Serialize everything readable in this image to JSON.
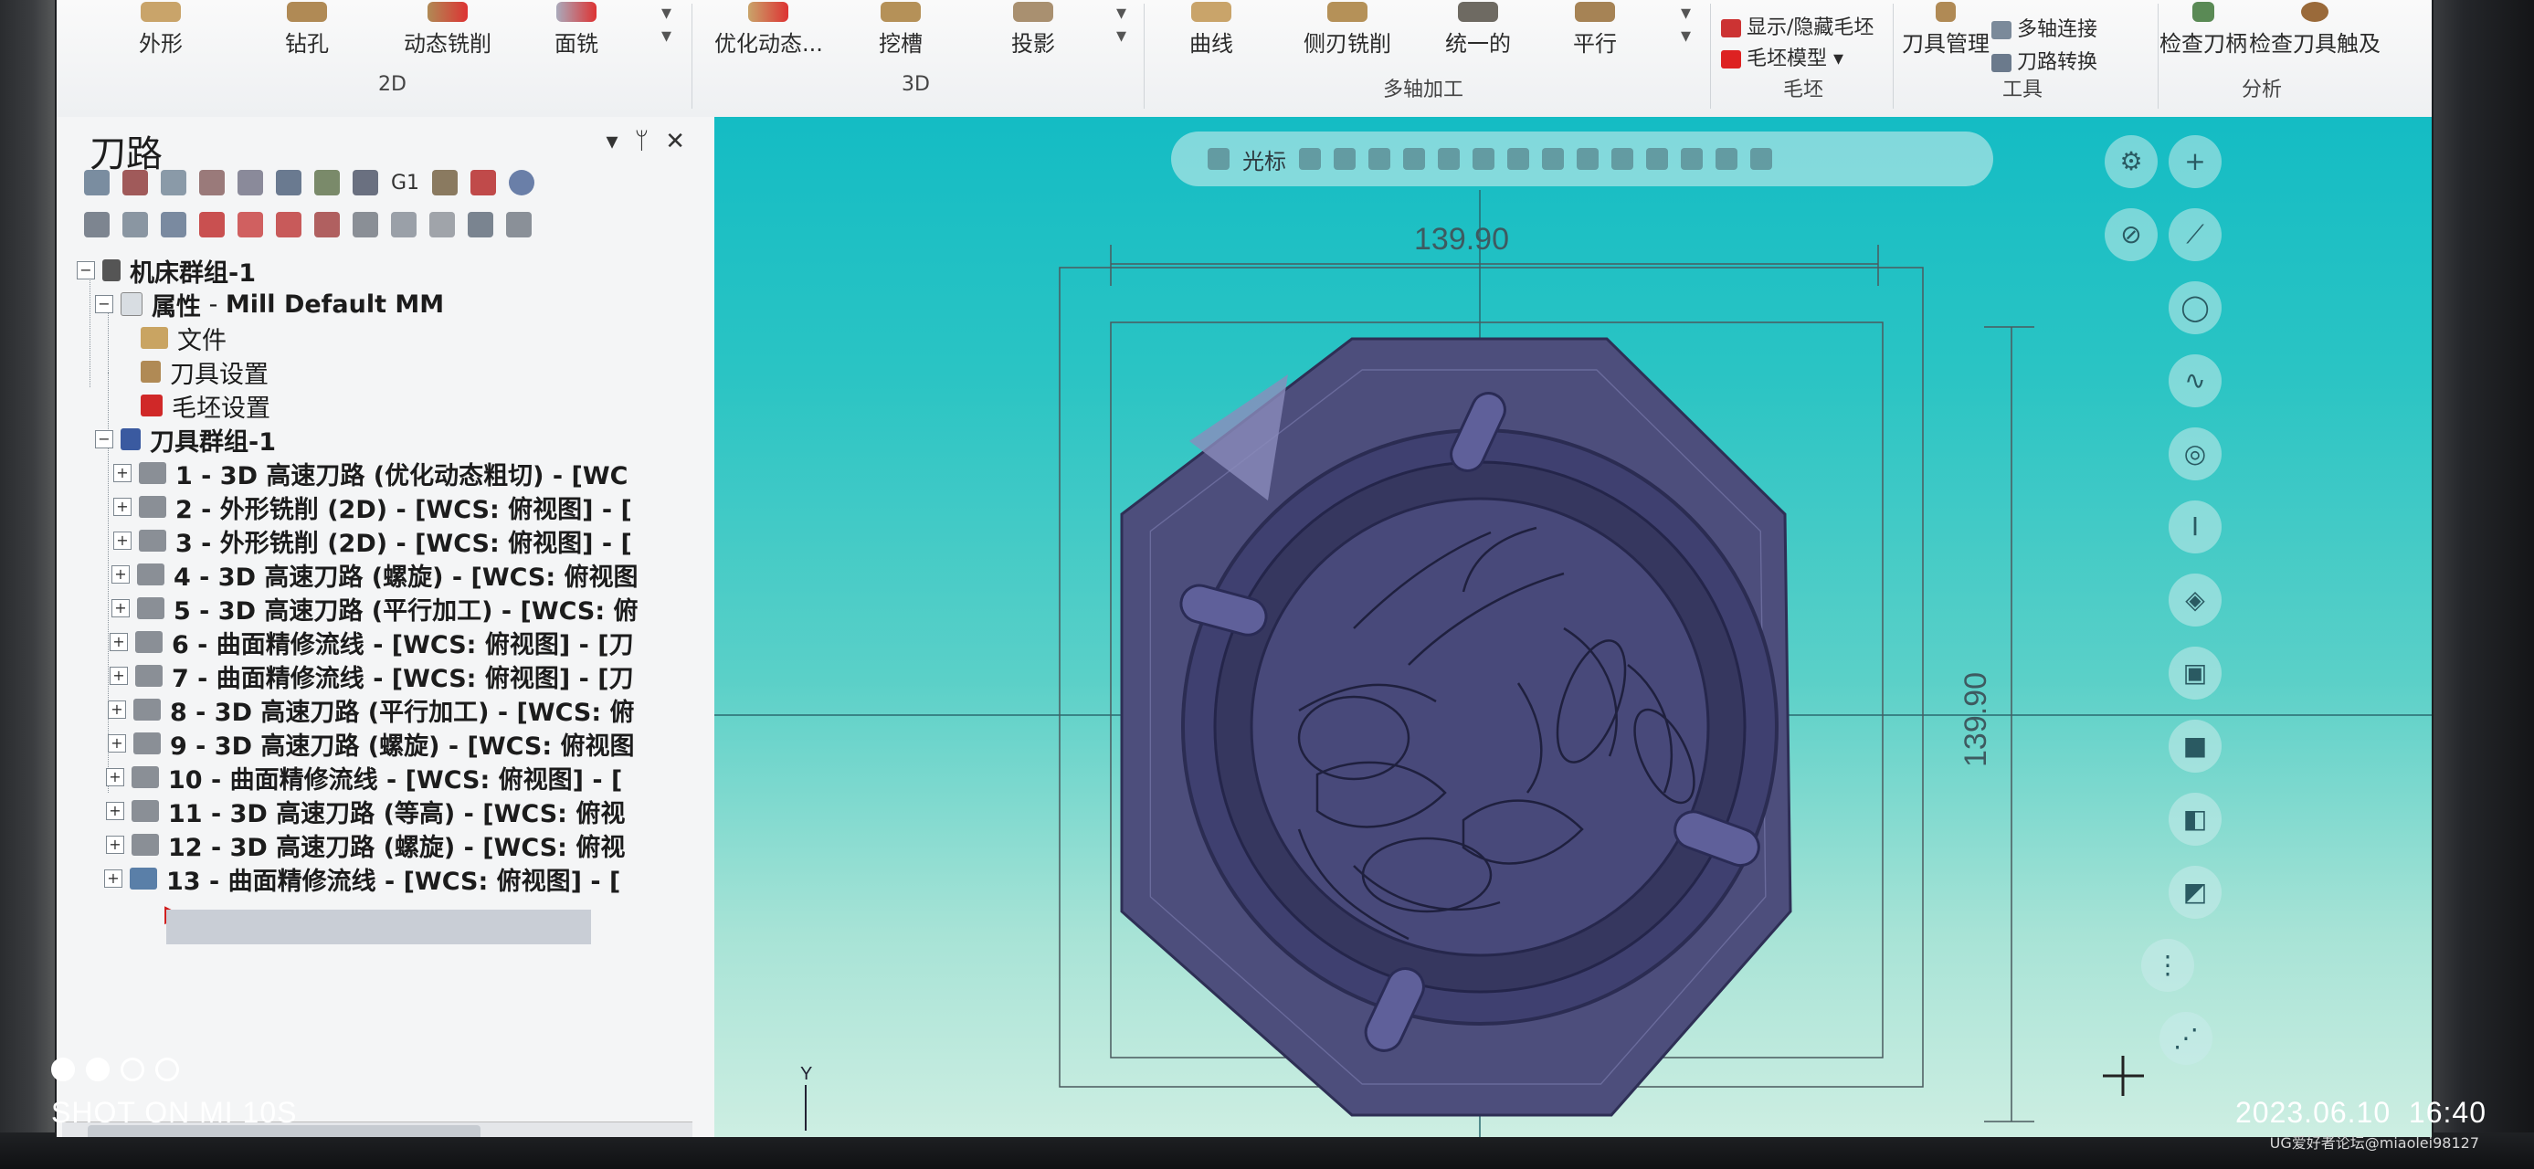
{
  "ribbon": {
    "buttons_2d": [
      "外形",
      "钻孔",
      "动态铣削",
      "面铣"
    ],
    "buttons_3d": [
      "优化动态...",
      "挖槽",
      "投影"
    ],
    "buttons_multiaxis": [
      "曲线",
      "侧刃铣削",
      "统一的",
      "平行"
    ],
    "stock_items": [
      "显示/隐藏毛坯",
      "毛坯模型"
    ],
    "tool_items": [
      "刀具管理",
      "多轴连接",
      "刀路转换"
    ],
    "analysis_items": [
      "检查刀柄",
      "检查刀具触及"
    ],
    "groups": [
      "2D",
      "3D",
      "多轴加工",
      "毛坯",
      "工具",
      "分析"
    ]
  },
  "panel": {
    "title": "刀路",
    "controls": [
      "▾",
      "ᛘ",
      "✕"
    ],
    "toolbar_g1": "G1",
    "tree": {
      "machine_group": "机床群组-1",
      "properties": "属性",
      "properties_value": "Mill Default MM",
      "files": "文件",
      "tool_settings": "刀具设置",
      "stock_settings": "毛坯设置",
      "tool_group": "刀具群组-1",
      "ops": [
        "1 - 3D 高速刀路 (优化动态粗切) - [WC",
        "2 - 外形铣削 (2D) - [WCS: 俯视图] - [",
        "3 - 外形铣削 (2D) - [WCS: 俯视图] - [",
        "4 - 3D 高速刀路 (螺旋) - [WCS: 俯视图",
        "5 - 3D 高速刀路 (平行加工) - [WCS: 俯",
        "6 - 曲面精修流线 - [WCS: 俯视图] - [刀",
        "7 - 曲面精修流线 - [WCS: 俯视图] - [刀",
        "8 - 3D 高速刀路 (平行加工) - [WCS: 俯",
        "9 - 3D 高速刀路 (螺旋) - [WCS: 俯视图",
        "10 - 曲面精修流线 - [WCS: 俯视图] - [",
        "11 - 3D 高速刀路 (等高) - [WCS: 俯视",
        "12 - 3D 高速刀路 (螺旋) - [WCS: 俯视",
        "13 - 曲面精修流线 - [WCS: 俯视图] - ["
      ]
    }
  },
  "viewport": {
    "toolbar_label": "光标",
    "dim_horizontal": "139.90",
    "dim_vertical": "139.90",
    "axis_label": "Y",
    "model_color": "#4a4b78",
    "bg_top": "#14bcc4",
    "bg_bottom": "#cdeee2"
  },
  "overlay": {
    "camera_label": "SHOT ON MI 10S",
    "date": "2023.06.10",
    "time": "16:40",
    "forum_watermark": "UG爱好者论坛@miaolei98127"
  }
}
